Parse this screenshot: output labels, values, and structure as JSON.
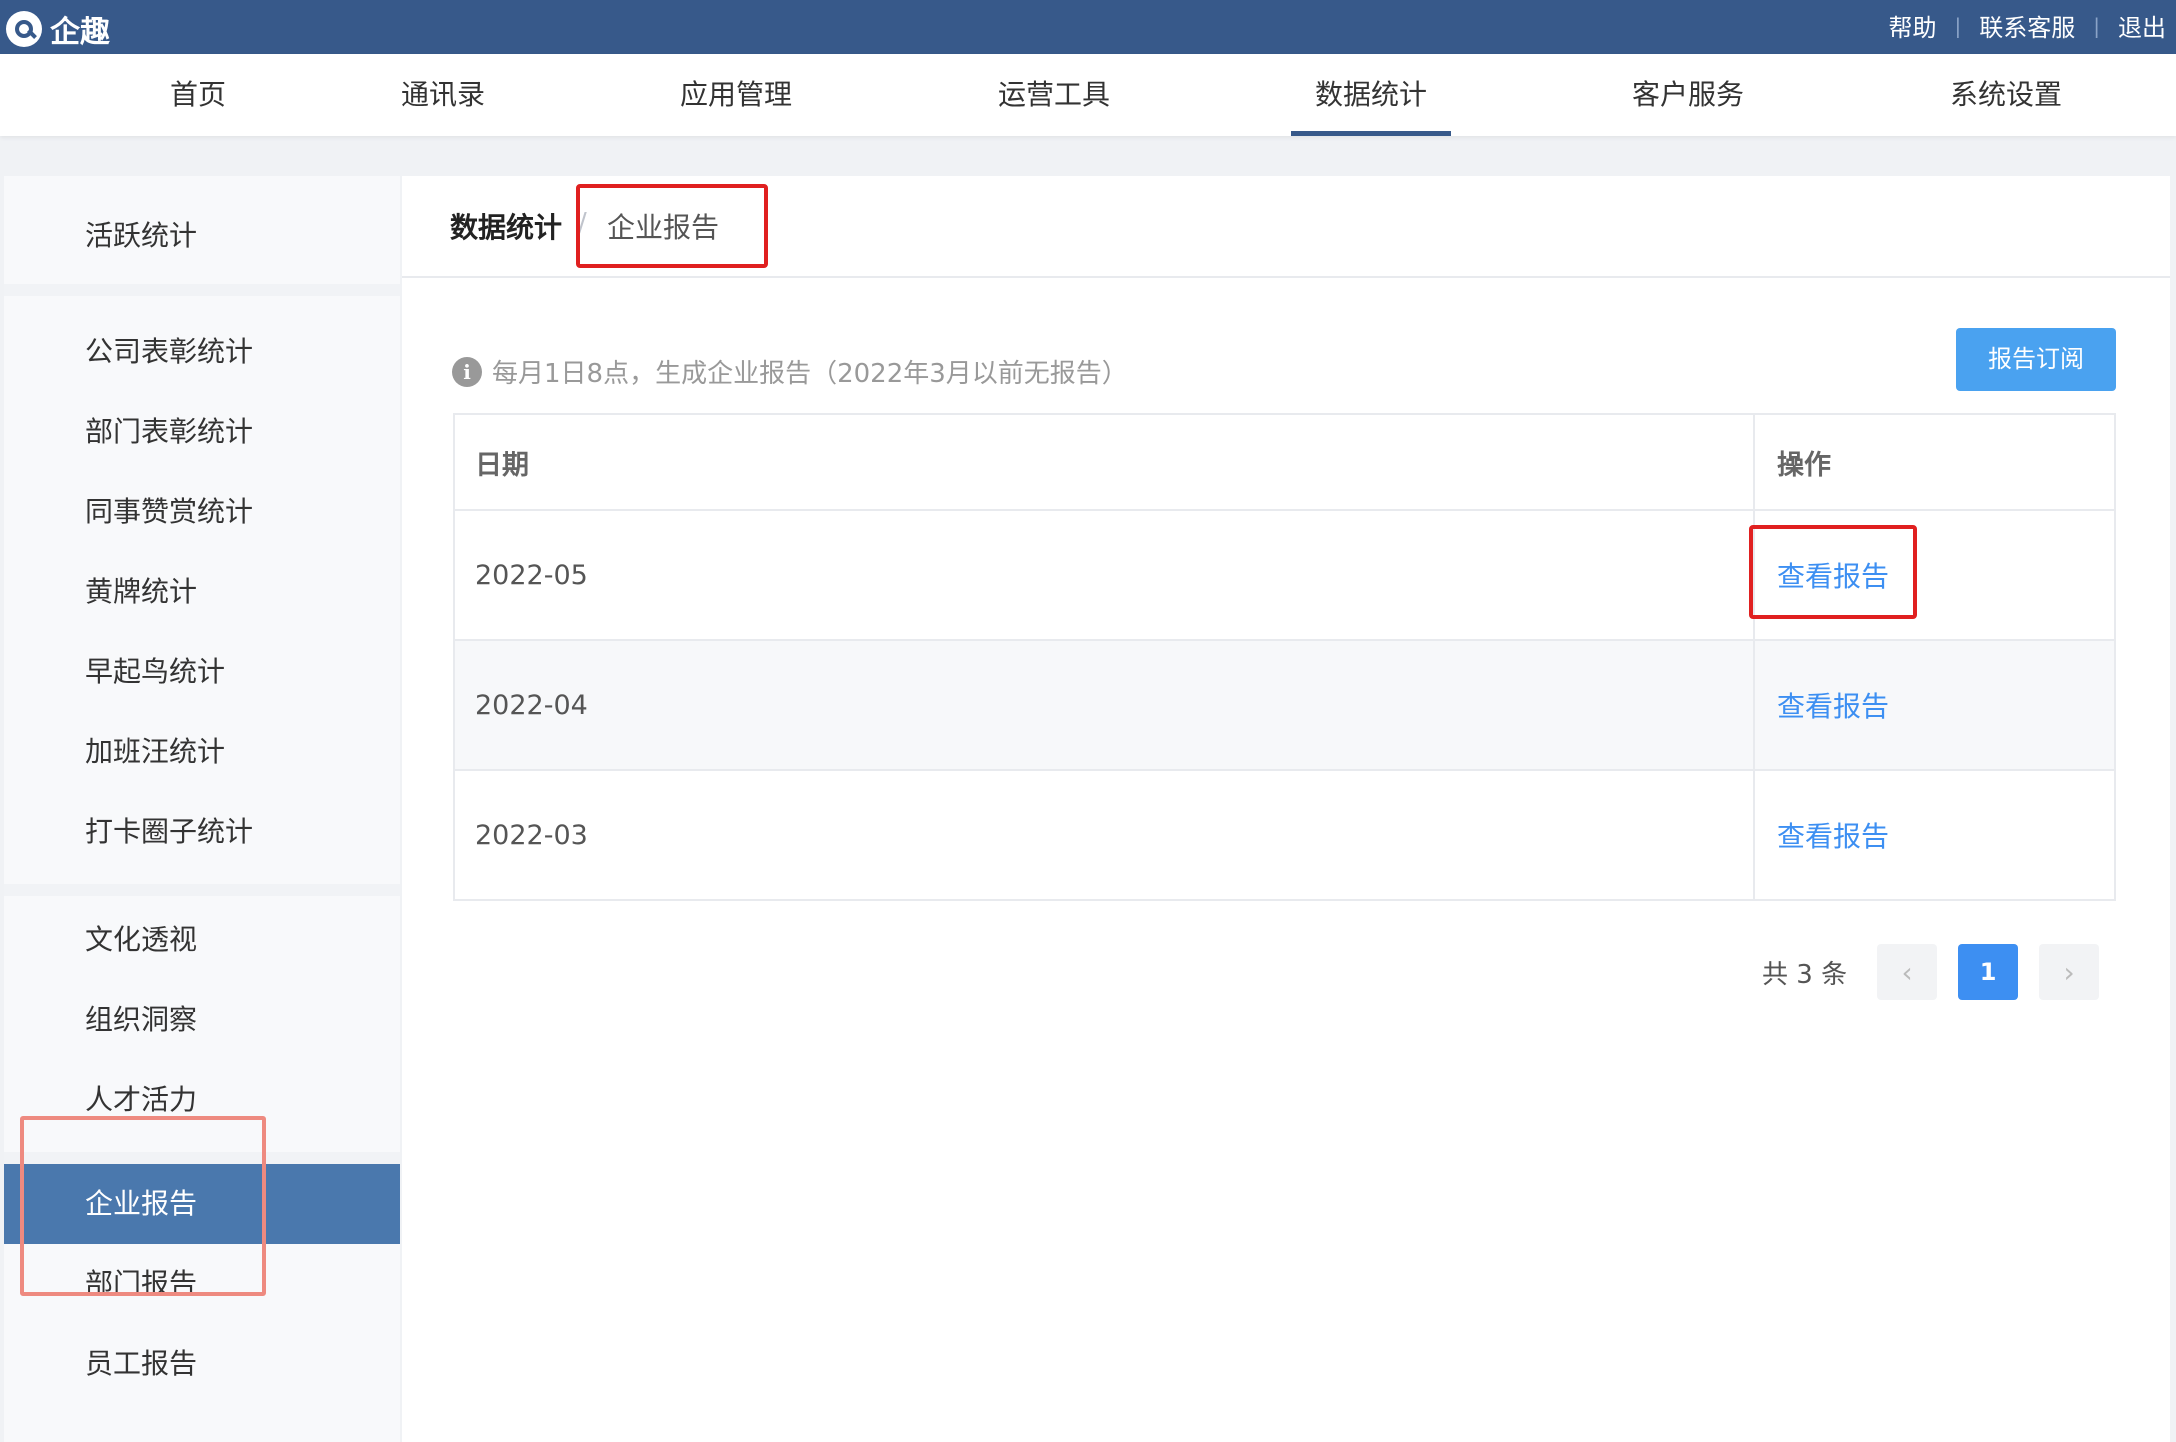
{
  "app": {
    "name": "企趣"
  },
  "top_links": [
    "帮助",
    "联系客服",
    "退出"
  ],
  "nav": {
    "items": [
      "首页",
      "通讯录",
      "应用管理",
      "运营工具",
      "数据统计",
      "客户服务",
      "系统设置"
    ],
    "active": "数据统计"
  },
  "sidebar": {
    "groups": [
      [
        "活跃统计"
      ],
      [
        "公司表彰统计",
        "部门表彰统计",
        "同事赞赏统计",
        "黄牌统计",
        "早起鸟统计",
        "加班汪统计",
        "打卡圈子统计"
      ],
      [
        "文化透视",
        "组织洞察",
        "人才活力"
      ],
      [
        "企业报告",
        "部门报告",
        "员工报告"
      ]
    ],
    "active": "企业报告"
  },
  "breadcrumb": {
    "root": "数据统计",
    "separator": "/",
    "current": "企业报告"
  },
  "notice": "每月1日8点，生成企业报告（2022年3月以前无报告）",
  "subscribe_button": "报告订阅",
  "table": {
    "headers": {
      "date": "日期",
      "action": "操作"
    },
    "rows": [
      {
        "date": "2022-05",
        "action": "查看报告"
      },
      {
        "date": "2022-04",
        "action": "查看报告"
      },
      {
        "date": "2022-03",
        "action": "查看报告"
      }
    ]
  },
  "pagination": {
    "total_text": "共 3 条",
    "prev": "‹",
    "current_page": "1",
    "next": "›"
  },
  "colors": {
    "header_bg": "#37598a",
    "active_sidebar": "#4a78ad",
    "accent": "#3d8ff2",
    "highlight": "#e02020"
  }
}
